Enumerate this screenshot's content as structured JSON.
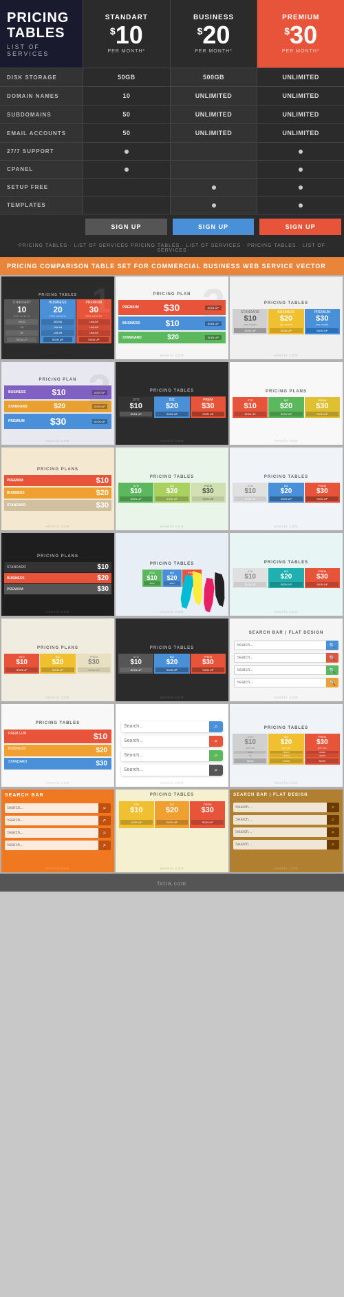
{
  "brand": {
    "title": "PRICING\nTABLES",
    "subtitle": "LIST OF SERVICES"
  },
  "plans": [
    {
      "name": "STANDART",
      "price": "10",
      "period": "PER MONTH*",
      "type": "std"
    },
    {
      "name": "BUSINESS",
      "price": "20",
      "period": "PER MONTH*",
      "type": "biz"
    },
    {
      "name": "PREMIUM",
      "price": "30",
      "period": "PER MONTH*",
      "type": "prem"
    }
  ],
  "features": [
    {
      "label": "DISK STORAGE",
      "values": [
        "50GB",
        "500GB",
        "UNLIMITED"
      ]
    },
    {
      "label": "DOMAIN NAMES",
      "values": [
        "10",
        "UNLIMITED",
        "UNLIMITED"
      ]
    },
    {
      "label": "SUBDOMAINS",
      "values": [
        "50",
        "UNLIMITED",
        "UNLIMITED"
      ]
    },
    {
      "label": "EMAIL ACCOUNTS",
      "values": [
        "50",
        "UNLIMITED",
        "UNLIMITED"
      ]
    },
    {
      "label": "27/7 SUPPORT",
      "values": [
        "dot",
        "",
        "dot"
      ]
    },
    {
      "label": "CPANEL",
      "values": [
        "dot",
        "",
        "dot"
      ]
    },
    {
      "label": "SETUP FREE",
      "values": [
        "",
        "dot",
        "dot"
      ]
    },
    {
      "label": "TEMPLATES",
      "values": [
        "",
        "dot",
        "dot"
      ]
    }
  ],
  "signupLabel": "SIGN UP",
  "tableFooter": "PRICING TABLES · LIST OF SERVICES PRICING TABLES · LIST OF SERVICES · PRICING TABLES · LIST OF SERVICES",
  "bannerText": "PRICING COMPARISON TABLE SET FOR COMMERCIAL BUSINESS WEB SERVICE VECTOR",
  "thumbnails": [
    {
      "bg": "dark",
      "title": "PRICING TABLES",
      "prices": [
        "10",
        "20",
        "30"
      ],
      "colors": [
        "#555",
        "#4a90d9",
        "#e8543a"
      ]
    },
    {
      "bg": "light",
      "title": "PRICING PLAN",
      "prices": [
        "30",
        "10",
        "20"
      ],
      "colors": [
        "#e8543a",
        "#4a90d9",
        "#5cb85c"
      ]
    },
    {
      "bg": "light",
      "title": "PRICING TABLES",
      "prices": [
        "10",
        "20",
        "30"
      ],
      "colors": [
        "#e0e0e0",
        "#f0c030",
        "#4a90d9"
      ]
    },
    {
      "bg": "light",
      "title": "PRICING PLAN",
      "prices": [
        "10",
        "20",
        "30"
      ],
      "colors": [
        "#8080c0",
        "#e8a030",
        "#4a90d9"
      ]
    },
    {
      "bg": "light",
      "title": "PRICING TABLES",
      "prices": [
        "10",
        "20",
        "30"
      ],
      "colors": [
        "#2b2b2b",
        "#4a90d9",
        "#e8543a"
      ]
    },
    {
      "bg": "light",
      "title": "PRICING PLANS",
      "prices": [
        "10",
        "20",
        "30"
      ],
      "colors": [
        "#e8543a",
        "#5cb85c",
        "#e0c030"
      ]
    },
    {
      "bg": "orange",
      "title": "PRICING PLANS",
      "prices": [
        "10",
        "20",
        "30"
      ],
      "colors": [
        "#e8543a",
        "#f0a030",
        "#e0e0e0"
      ]
    },
    {
      "bg": "green",
      "title": "PRICING TABLES",
      "prices": [
        "10",
        "20",
        "30"
      ],
      "colors": [
        "#5cb85c",
        "#aad060",
        "#e8e8e8"
      ]
    },
    {
      "bg": "light",
      "title": "PRICING TABLES",
      "prices": [
        "10",
        "20",
        "30"
      ],
      "colors": [
        "#e8e8e8",
        "#4a90d9",
        "#e8543a"
      ]
    },
    {
      "bg": "dark2",
      "title": "PRICING PLANS",
      "prices": [
        "10",
        "20",
        "30"
      ],
      "colors": [
        "#444",
        "#e8543a",
        "#e0e0e0"
      ]
    },
    {
      "bg": "splatter",
      "title": "PRICING TABLES",
      "prices": [
        "10",
        "20",
        "30"
      ],
      "colors": [
        "#5cb85c",
        "#4a90d9",
        "#e8543a"
      ]
    },
    {
      "bg": "light",
      "title": "PRICING TABLES",
      "prices": [
        "10",
        "20",
        "30"
      ],
      "colors": [
        "#e8e8e8",
        "#20b0b0",
        "#e8543a"
      ]
    }
  ],
  "searchBars": {
    "title": "SEARCH BAR | FLAT DESIGN",
    "bars": [
      {
        "placeholder": "Search...",
        "btnColor": "#4a90d9"
      },
      {
        "placeholder": "Search...",
        "btnColor": "#e8543a"
      },
      {
        "placeholder": "Search...",
        "btnColor": "#5cb85c"
      },
      {
        "placeholder": "Search...",
        "btnColor": "#f0a030"
      }
    ]
  },
  "bottomRow": {
    "leftSearch": {
      "bg": "#f07820",
      "title": "SEARCH BAR",
      "bars": [
        {
          "placeholder": "Search...",
          "btnColor": "#c05010"
        },
        {
          "placeholder": "Search...",
          "btnColor": "#c05010"
        },
        {
          "placeholder": "Search...",
          "btnColor": "#c05010"
        },
        {
          "placeholder": "Search...",
          "btnColor": "#c05010"
        }
      ]
    },
    "centerPricing": {
      "bg": "#f5f0d0",
      "title": "PRICING TABLES",
      "prices": [
        "10",
        "20",
        "30"
      ],
      "colors": [
        "#f0c030",
        "#f0a030",
        "#e8543a"
      ]
    },
    "rightSearch": {
      "bg": "#c09040",
      "title": "SEARCH BAR | FLAT DESIGN",
      "bars": [
        {
          "placeholder": "Search...",
          "btnColor": "#8a5a10"
        },
        {
          "placeholder": "Search...",
          "btnColor": "#8a5a10"
        },
        {
          "placeholder": "Search...",
          "btnColor": "#8a5a10"
        },
        {
          "placeholder": "Search...",
          "btnColor": "#8a5a10"
        }
      ]
    }
  },
  "watermark": "vexels.com"
}
